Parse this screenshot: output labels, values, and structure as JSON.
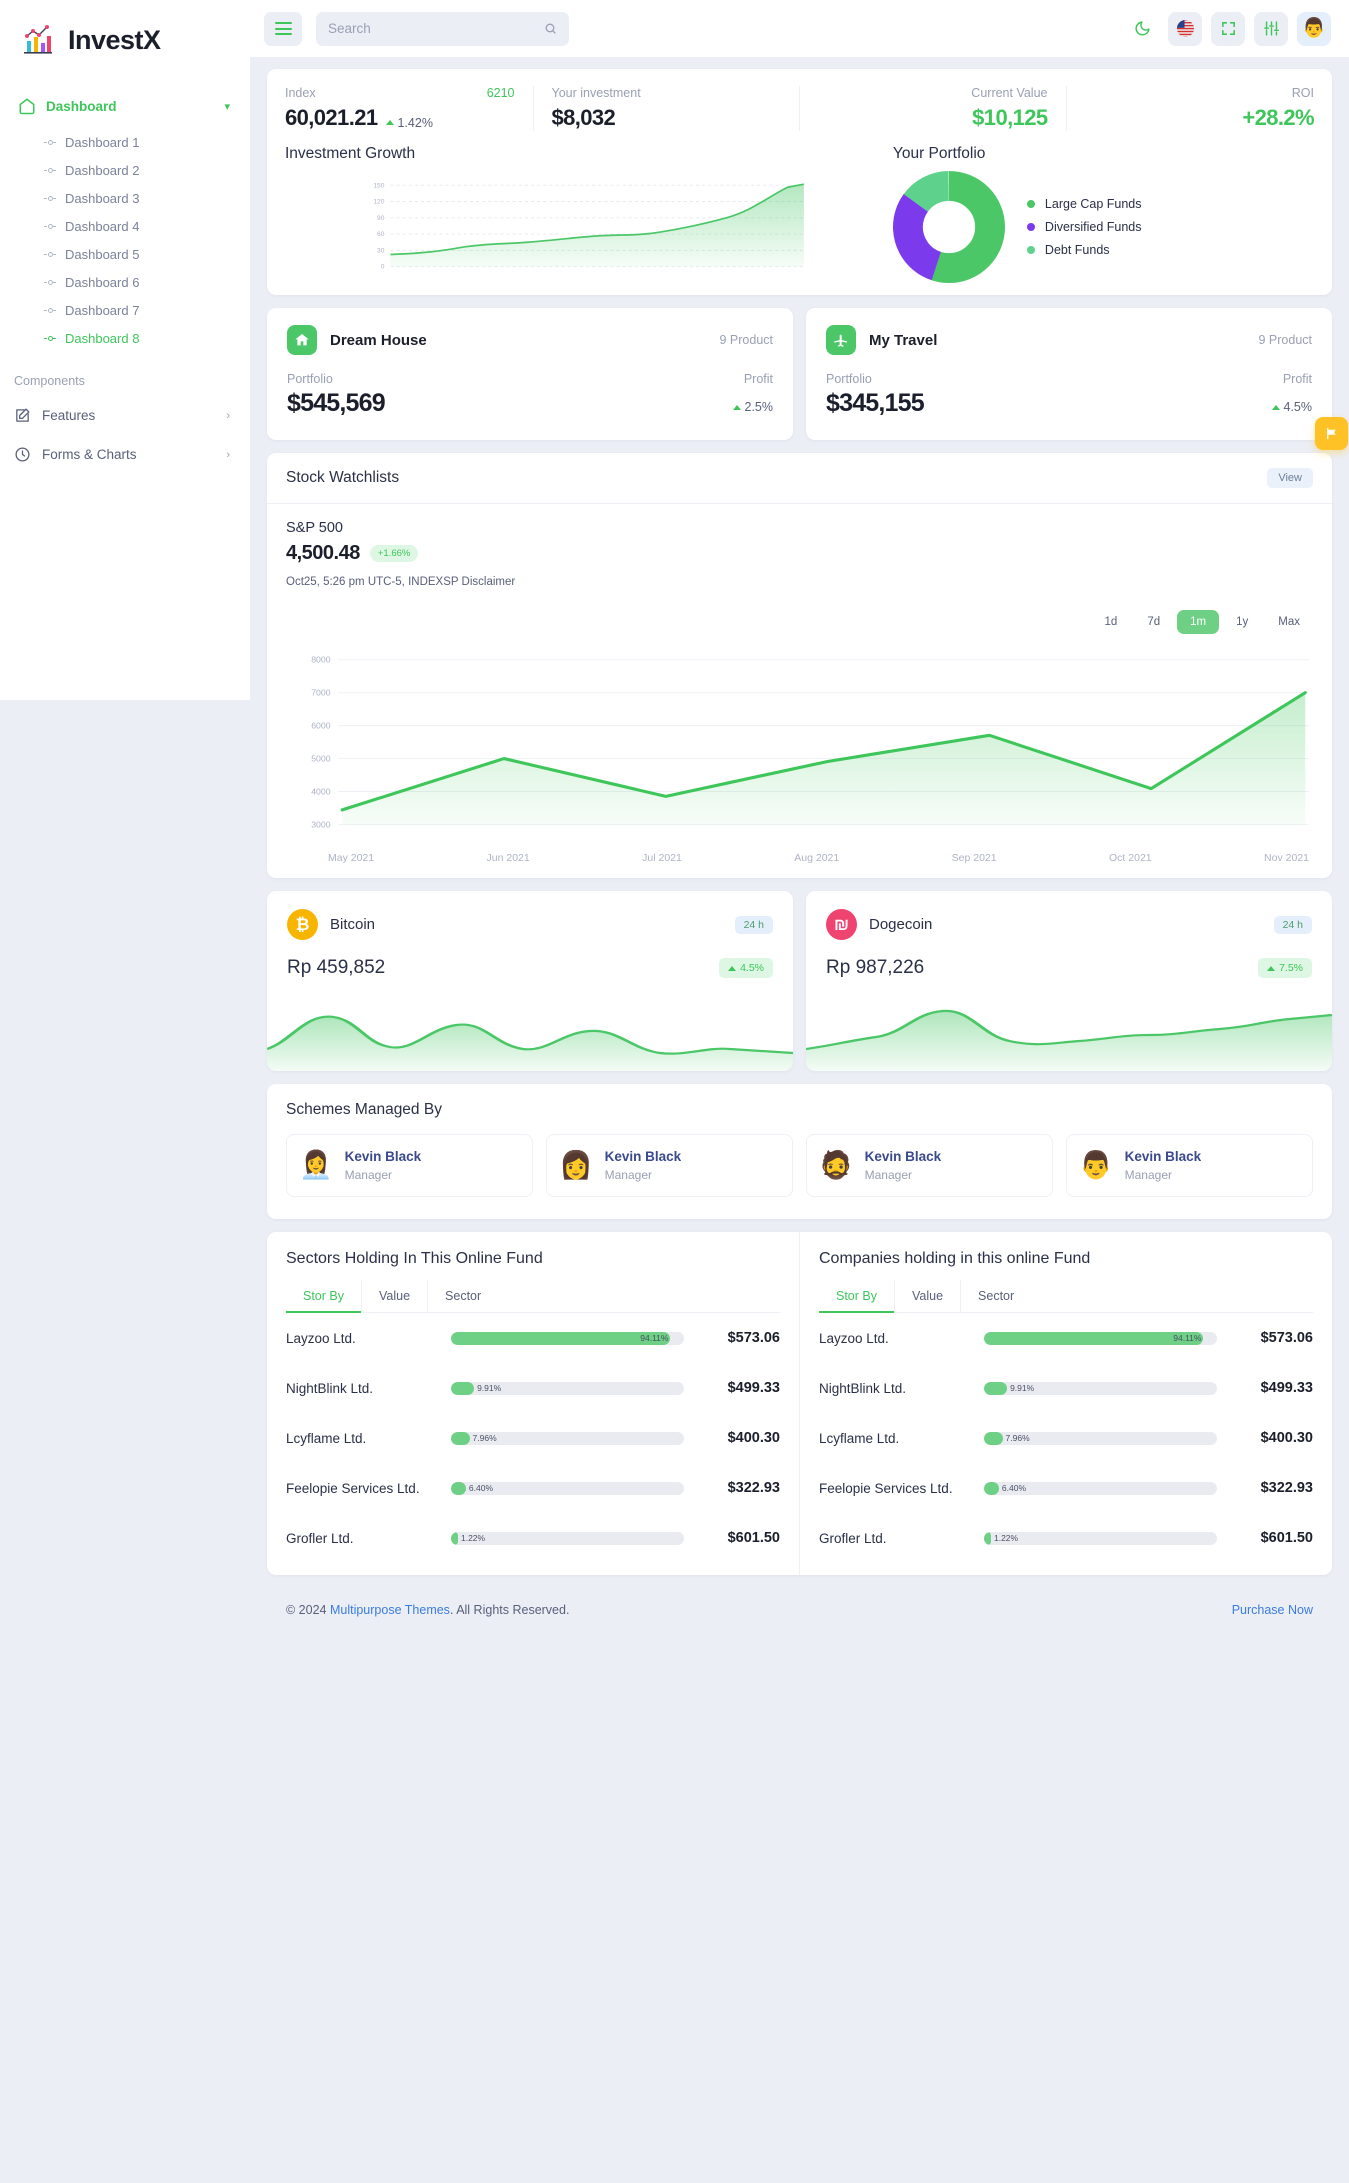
{
  "brand": {
    "name": "InvestX",
    "logo_icon": "bar-chart-logo-icon"
  },
  "sidebar": {
    "main_item": {
      "label": "Dashboard",
      "icon": "home-icon",
      "chevron": "chevron-down-icon"
    },
    "dashboards": [
      {
        "label": "Dashboard 1",
        "active": false
      },
      {
        "label": "Dashboard 2",
        "active": false
      },
      {
        "label": "Dashboard 3",
        "active": false
      },
      {
        "label": "Dashboard 4",
        "active": false
      },
      {
        "label": "Dashboard 5",
        "active": false
      },
      {
        "label": "Dashboard 6",
        "active": false
      },
      {
        "label": "Dashboard 7",
        "active": false
      },
      {
        "label": "Dashboard 8",
        "active": true
      }
    ],
    "section_label": "Components",
    "rows": [
      {
        "label": "Features",
        "icon": "edit-square-icon",
        "chevron": "chevron-right-icon"
      },
      {
        "label": "Forms & Charts",
        "icon": "clock-icon",
        "chevron": "chevron-right-icon"
      }
    ]
  },
  "topbar": {
    "menu_icon": "hamburger-menu-icon",
    "search": {
      "placeholder": "Search",
      "value": "",
      "icon": "search-icon"
    },
    "actions": [
      {
        "name": "dark-mode-toggle",
        "icon": "moon-icon"
      },
      {
        "name": "language-flag",
        "icon": "us-flag-icon"
      },
      {
        "name": "fullscreen-toggle",
        "icon": "fullscreen-icon"
      },
      {
        "name": "settings",
        "icon": "sliders-icon"
      },
      {
        "name": "profile",
        "icon": "avatar-icon"
      }
    ]
  },
  "stats": [
    {
      "label": "Index",
      "sub": "6210",
      "value": "60,021.21",
      "change": "1.42%",
      "green": false
    },
    {
      "label": "Your investment",
      "sub": "",
      "value": "$8,032",
      "change": "",
      "green": false
    },
    {
      "label": "Current Value",
      "sub": "",
      "value": "$10,125",
      "change": "",
      "green": true
    },
    {
      "label": "ROI",
      "sub": "",
      "value": "+28.2%",
      "change": "",
      "green": true
    }
  ],
  "growth": {
    "title": "Investment Growth"
  },
  "portfolio": {
    "title": "Your Portfolio",
    "legend": [
      {
        "label": "Large Cap Funds",
        "color": "#4bc768"
      },
      {
        "label": "Diversified Funds",
        "color": "#7c3aed"
      },
      {
        "label": "Debt Funds",
        "color": "#5ed18d"
      }
    ]
  },
  "product_cards": [
    {
      "name": "Dream House",
      "icon": "home-icon",
      "count": "9 Product",
      "portfolio_label": "Portfolio",
      "profit_label": "Profit",
      "value": "$545,569",
      "profit": "2.5%"
    },
    {
      "name": "My Travel",
      "icon": "plane-icon",
      "count": "9 Product",
      "portfolio_label": "Portfolio",
      "profit_label": "Profit",
      "value": "$345,155",
      "profit": "4.5%"
    }
  ],
  "flag_button": {
    "icon": "flag-icon"
  },
  "watchlist": {
    "title": "Stock Watchlists",
    "view_label": "View",
    "index_name": "S&P 500",
    "price": "4,500.48",
    "change_badge": "+1.66%",
    "meta": "Oct25, 5:26 pm UTC-5, INDEXSP Disclaimer",
    "ranges": [
      {
        "label": "1d",
        "active": false
      },
      {
        "label": "7d",
        "active": false
      },
      {
        "label": "1m",
        "active": true
      },
      {
        "label": "1y",
        "active": false
      },
      {
        "label": "Max",
        "active": false
      }
    ]
  },
  "crypto": [
    {
      "name": "Bitcoin",
      "symbol": "₿",
      "color": "#f7b500",
      "badge": "24 h",
      "price": "Rp 459,852",
      "change": "4.5%"
    },
    {
      "name": "Dogecoin",
      "symbol": "₪",
      "color": "#ef4470",
      "badge": "24 h",
      "price": "Rp 987,226",
      "change": "7.5%"
    }
  ],
  "schemes": {
    "title": "Schemes Managed By",
    "people": [
      {
        "name": "Kevin Black",
        "role": "Manager",
        "avatar": "👩‍💼"
      },
      {
        "name": "Kevin Black",
        "role": "Manager",
        "avatar": "👩"
      },
      {
        "name": "Kevin Black",
        "role": "Manager",
        "avatar": "🧔"
      },
      {
        "name": "Kevin Black",
        "role": "Manager",
        "avatar": "👨"
      }
    ]
  },
  "holdings": [
    {
      "title": "Sectors Holding In This Online Fund",
      "tabs": [
        {
          "label": "Stor By",
          "active": true
        },
        {
          "label": "Value",
          "active": false
        },
        {
          "label": "Sector",
          "active": false
        }
      ],
      "rows": [
        {
          "name": "Layzoo Ltd.",
          "pct": "94.11%",
          "pct_num": 94.11,
          "amount": "$573.06"
        },
        {
          "name": "NightBlink Ltd.",
          "pct": "9.91%",
          "pct_num": 9.91,
          "amount": "$499.33"
        },
        {
          "name": "Lcyflame Ltd.",
          "pct": "7.96%",
          "pct_num": 7.96,
          "amount": "$400.30"
        },
        {
          "name": "Feelopie Services Ltd.",
          "pct": "6.40%",
          "pct_num": 6.4,
          "amount": "$322.93"
        },
        {
          "name": "Grofler Ltd.",
          "pct": "1.22%",
          "pct_num": 1.22,
          "amount": "$601.50"
        }
      ]
    },
    {
      "title": "Companies holding in this online Fund",
      "tabs": [
        {
          "label": "Stor By",
          "active": true
        },
        {
          "label": "Value",
          "active": false
        },
        {
          "label": "Sector",
          "active": false
        }
      ],
      "rows": [
        {
          "name": "Layzoo Ltd.",
          "pct": "94.11%",
          "pct_num": 94.11,
          "amount": "$573.06"
        },
        {
          "name": "NightBlink Ltd.",
          "pct": "9.91%",
          "pct_num": 9.91,
          "amount": "$499.33"
        },
        {
          "name": "Lcyflame Ltd.",
          "pct": "7.96%",
          "pct_num": 7.96,
          "amount": "$400.30"
        },
        {
          "name": "Feelopie Services Ltd.",
          "pct": "6.40%",
          "pct_num": 6.4,
          "amount": "$322.93"
        },
        {
          "name": "Grofler Ltd.",
          "pct": "1.22%",
          "pct_num": 1.22,
          "amount": "$601.50"
        }
      ]
    }
  ],
  "footer": {
    "copyright_prefix": "© 2024 ",
    "link": "Multipurpose Themes",
    "copyright_suffix": ". All Rights Reserved.",
    "purchase": "Purchase Now"
  },
  "chart_data": [
    {
      "type": "area",
      "title": "Investment Growth",
      "xlabel": "",
      "ylabel": "",
      "ylim": [
        0,
        165
      ],
      "yticks": [
        0,
        30,
        60,
        90,
        120,
        150
      ],
      "grid": true,
      "legend": "none",
      "x": [
        0,
        1,
        2,
        3,
        4,
        5,
        6,
        7,
        8,
        9,
        10,
        11,
        12,
        13,
        14,
        15,
        16,
        17,
        18
      ],
      "values": [
        22,
        24,
        26,
        32,
        38,
        40,
        39,
        42,
        46,
        50,
        52,
        50,
        54,
        58,
        62,
        70,
        88,
        118,
        140
      ],
      "color": "#4bc768"
    },
    {
      "type": "pie",
      "title": "Your Portfolio",
      "labels": [
        "Large Cap Funds",
        "Diversified Funds",
        "Debt Funds"
      ],
      "values": [
        55,
        30,
        15
      ],
      "colors": [
        "#4bc768",
        "#7c3aed",
        "#5ed18d"
      ],
      "legend": "right",
      "donut": true
    },
    {
      "type": "area",
      "title": "S&P 500",
      "xlabel": "",
      "ylabel": "",
      "ylim": [
        3000,
        8000
      ],
      "yticks": [
        3000,
        4000,
        5000,
        6000,
        7000,
        8000
      ],
      "categories": [
        "May 2021",
        "Jun 2021",
        "Jul 2021",
        "Aug 2021",
        "Sep 2021",
        "Oct 2021",
        "Nov 2021"
      ],
      "values": [
        3450,
        5000,
        3850,
        4900,
        5700,
        4100,
        7000
      ],
      "grid": true,
      "color": "#3ec65a"
    },
    {
      "type": "area",
      "title": "Bitcoin",
      "x": [
        0,
        1,
        2,
        3,
        4,
        5,
        6,
        7,
        8,
        9,
        10,
        11,
        12,
        13,
        14,
        15,
        16,
        17,
        18,
        19,
        20
      ],
      "values": [
        18,
        40,
        70,
        52,
        38,
        55,
        40,
        30,
        48,
        34,
        24,
        44,
        58,
        38,
        26,
        30,
        22,
        16,
        12,
        18,
        16
      ],
      "color": "#4bc768",
      "grid": false
    },
    {
      "type": "area",
      "title": "Dogecoin",
      "x": [
        0,
        1,
        2,
        3,
        4,
        5,
        6,
        7,
        8,
        9,
        10,
        11,
        12,
        13,
        14,
        15,
        16,
        17,
        18,
        19,
        20
      ],
      "values": [
        20,
        26,
        22,
        30,
        56,
        62,
        48,
        30,
        26,
        36,
        30,
        26,
        30,
        34,
        38,
        34,
        40,
        44,
        50,
        56,
        62
      ],
      "color": "#4bc768",
      "grid": false
    }
  ]
}
